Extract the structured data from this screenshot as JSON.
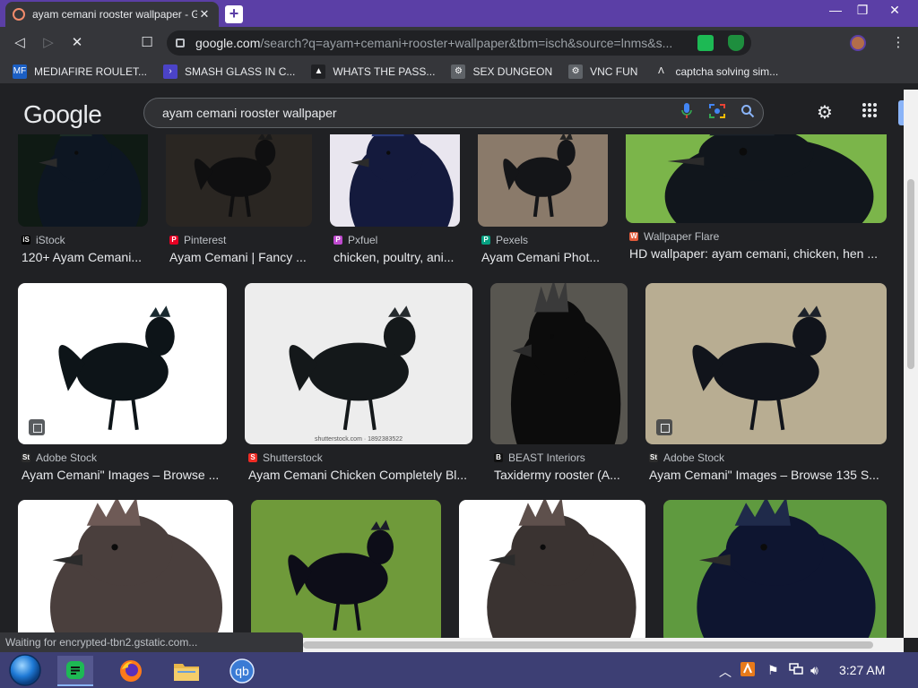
{
  "browser": {
    "tab_title": "ayam cemani rooster wallpaper - G",
    "tab_close": "✕",
    "new_tab": "+",
    "window_controls": {
      "minimize": "—",
      "restore": "❐",
      "close": "✕"
    },
    "nav": {
      "back": "◁",
      "forward": "▷",
      "stop": "✕",
      "bookmark": "☐"
    },
    "url_domain": "google.com",
    "url_rest": "/search?q=ayam+cemani+rooster+wallpaper&tbm=isch&source=lnms&s...",
    "menu": "⋮",
    "bookmarks": [
      {
        "label": "MEDIAFIRE ROULET...",
        "icon": "mediafire-icon",
        "color": "#1b5fc4",
        "glyph": "MF"
      },
      {
        "label": "SMASH GLASS IN C...",
        "icon": "bookmark-link-icon",
        "color": "#4b43c7",
        "glyph": "›"
      },
      {
        "label": "WHATS THE PASS...",
        "icon": "site-icon",
        "color": "#202124",
        "glyph": "▲"
      },
      {
        "label": "SEX DUNGEON",
        "icon": "gear-site-icon",
        "color": "#5f6368",
        "glyph": "⚙"
      },
      {
        "label": "VNC FUN",
        "icon": "gear-site-icon",
        "color": "#5f6368",
        "glyph": "⚙"
      },
      {
        "label": "captcha solving sim...",
        "icon": "a-logo-icon",
        "color": "#35363a",
        "glyph": "Λ"
      }
    ]
  },
  "google": {
    "logo": "Google",
    "query": "ayam cemani rooster wallpaper",
    "settings": "⚙",
    "apps": "⋮⋮⋮"
  },
  "results": [
    {
      "source": "iStock",
      "fav": "iS",
      "fav_color": "#000000",
      "caption": "120+ Ayam Cemani..."
    },
    {
      "source": "Pinterest",
      "fav": "P",
      "fav_color": "#e60023",
      "caption": "Ayam Cemani | Fancy ..."
    },
    {
      "source": "Pxfuel",
      "fav": "P",
      "fav_color": "#c04ad0",
      "caption": "chicken, poultry, ani..."
    },
    {
      "source": "Pexels",
      "fav": "P",
      "fav_color": "#05a081",
      "caption": "Ayam Cemani Phot..."
    },
    {
      "source": "Wallpaper Flare",
      "fav": "W",
      "fav_color": "#e05a3a",
      "caption": "HD wallpaper: ayam cemani, chicken, hen ..."
    },
    {
      "source": "Adobe Stock",
      "fav": "St",
      "fav_color": "#2d2d2d",
      "caption": "Ayam Cemani\" Images – Browse ..."
    },
    {
      "source": "Shutterstock",
      "fav": "S",
      "fav_color": "#ee2b24",
      "caption": "Ayam Cemani Chicken Completely Bl..."
    },
    {
      "source": "BEAST Interiors",
      "fav": "B",
      "fav_color": "#111111",
      "caption": "Taxidermy rooster (A..."
    },
    {
      "source": "Adobe Stock",
      "fav": "St",
      "fav_color": "#2d2d2d",
      "caption": "Ayam Cemani\" Images – Browse 135 S..."
    }
  ],
  "watermark": "shutterstock.com · 1892383522",
  "status_text": "Waiting for encrypted-tbn2.gstatic.com...",
  "taskbar": {
    "clock": "3:27 AM"
  }
}
